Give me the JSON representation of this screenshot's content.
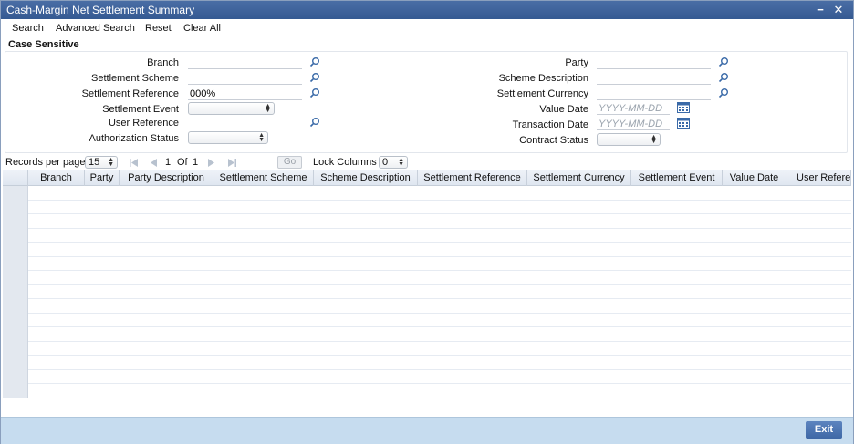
{
  "window": {
    "title": "Cash-Margin Net Settlement Summary",
    "minimize": "−",
    "close": "✕"
  },
  "menu": [
    "Search",
    "Advanced Search",
    "Reset",
    "Clear All"
  ],
  "section_title": "Case Sensitive",
  "fields": {
    "branch": {
      "label": "Branch",
      "value": ""
    },
    "settlement_scheme": {
      "label": "Settlement Scheme",
      "value": ""
    },
    "settlement_reference": {
      "label": "Settlement Reference",
      "value": "000%"
    },
    "settlement_event": {
      "label": "Settlement Event",
      "value": ""
    },
    "user_reference": {
      "label": "User Reference",
      "value": ""
    },
    "authorization_status": {
      "label": "Authorization Status",
      "value": ""
    },
    "party": {
      "label": "Party",
      "value": ""
    },
    "scheme_description": {
      "label": "Scheme Description",
      "value": ""
    },
    "settlement_currency": {
      "label": "Settlement Currency",
      "value": ""
    },
    "value_date": {
      "label": "Value Date",
      "placeholder": "YYYY-MM-DD"
    },
    "transaction_date": {
      "label": "Transaction Date",
      "placeholder": "YYYY-MM-DD"
    },
    "contract_status": {
      "label": "Contract Status",
      "value": ""
    }
  },
  "pager": {
    "records_label": "Records per page",
    "records_value": "15",
    "current_page": "1",
    "of_label": "Of",
    "total_pages": "1",
    "go_label": "Go",
    "lock_label": "Lock Columns",
    "lock_value": "0"
  },
  "grid": {
    "columns": [
      "Branch",
      "Party",
      "Party Description",
      "Settlement Scheme",
      "Scheme Description",
      "Settlement Reference",
      "Settlement Currency",
      "Settlement Event",
      "Value Date",
      "User Refere"
    ],
    "rows": 15
  },
  "footer": {
    "exit_label": "Exit"
  },
  "colors": {
    "titlebar": "#3f649c",
    "footer": "#c6dcef",
    "exit": "#4a72ae"
  }
}
